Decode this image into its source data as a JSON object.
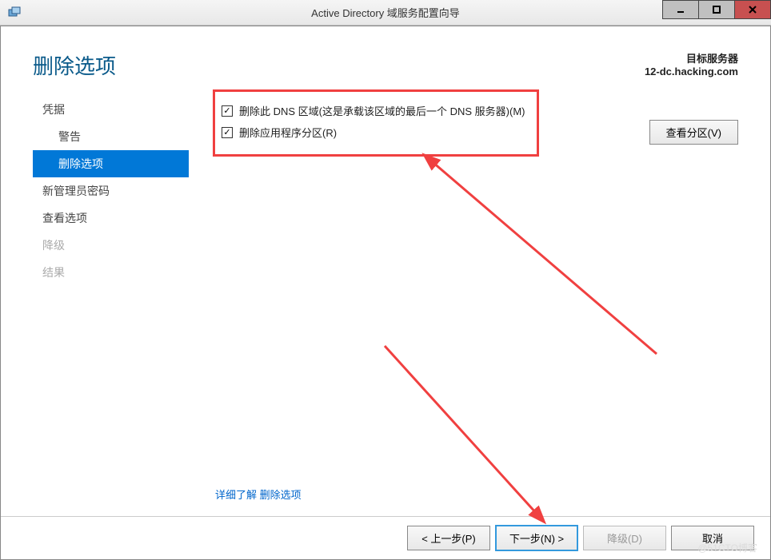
{
  "titlebar": {
    "title": "Active Directory 域服务配置向导"
  },
  "header": {
    "page_title": "删除选项",
    "target_label": "目标服务器",
    "target_server": "12-dc.hacking.com"
  },
  "sidebar": {
    "items": [
      {
        "label": "凭据",
        "indent": false,
        "active": false,
        "disabled": false
      },
      {
        "label": "警告",
        "indent": true,
        "active": false,
        "disabled": false
      },
      {
        "label": "删除选项",
        "indent": true,
        "active": true,
        "disabled": false
      },
      {
        "label": "新管理员密码",
        "indent": false,
        "active": false,
        "disabled": false
      },
      {
        "label": "查看选项",
        "indent": false,
        "active": false,
        "disabled": false
      },
      {
        "label": "降级",
        "indent": false,
        "active": false,
        "disabled": true
      },
      {
        "label": "结果",
        "indent": false,
        "active": false,
        "disabled": true
      }
    ]
  },
  "main": {
    "checkboxes": [
      {
        "label": "删除此 DNS 区域(这是承载该区域的最后一个 DNS 服务器)(M)",
        "checked": true
      },
      {
        "label": "删除应用程序分区(R)",
        "checked": true
      }
    ],
    "view_partition_btn": "查看分区(V)",
    "learn_more_prefix": "详细了解 ",
    "learn_more_link": "删除选项"
  },
  "footer": {
    "prev": "< 上一步(P)",
    "next": "下一步(N) >",
    "demote": "降级(D)",
    "cancel": "取消"
  },
  "watermark": "@51CTO博客"
}
